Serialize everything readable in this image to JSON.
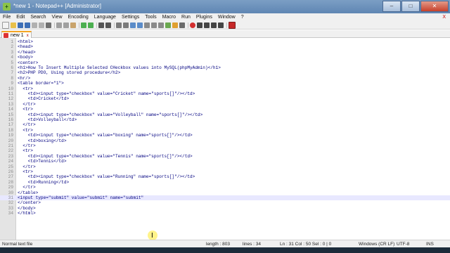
{
  "window": {
    "title": "*new 1 - Notepad++ [Administrator]",
    "app_icon": "notepad-plus-icon"
  },
  "menu": [
    "File",
    "Edit",
    "Search",
    "View",
    "Encoding",
    "Language",
    "Settings",
    "Tools",
    "Macro",
    "Run",
    "Plugins",
    "Window",
    "?"
  ],
  "menu_close": "X",
  "tab": {
    "label": "new 1",
    "close": "x"
  },
  "editor": {
    "current_line": 31,
    "lines": [
      {
        "n": "1",
        "text": "<html>"
      },
      {
        "n": "2",
        "text": "<head>"
      },
      {
        "n": "3",
        "text": "</head>"
      },
      {
        "n": "4",
        "text": "<body>"
      },
      {
        "n": "5",
        "text": "<center>"
      },
      {
        "n": "6",
        "text": "<h1>How To Insert Multiple Selected CHeckbox values into MySQL(phpMyAdmin)</h1>"
      },
      {
        "n": "7",
        "text": "<h2>PHP PDO, Using stored procedure</h2>"
      },
      {
        "n": "8",
        "text": "<hr/>"
      },
      {
        "n": "9",
        "text": "<table border=\"1\">"
      },
      {
        "n": "10",
        "text": "  <tr>"
      },
      {
        "n": "11",
        "text": "    <td><input type=\"checkbox\" value=\"Cricket\" name=\"sports[]\"/></td>"
      },
      {
        "n": "12",
        "text": "    <td>Cricket</td>"
      },
      {
        "n": "13",
        "text": "  </tr>"
      },
      {
        "n": "14",
        "text": "  <tr>"
      },
      {
        "n": "15",
        "text": "    <td><input type=\"checkbox\" value=\"Volleyball\" name=\"sports[]\"/></td>"
      },
      {
        "n": "16",
        "text": "    <td>Volleyball</td>"
      },
      {
        "n": "17",
        "text": "  </tr>"
      },
      {
        "n": "18",
        "text": "  <tr>"
      },
      {
        "n": "19",
        "text": "    <td><input type=\"checkbox\" value=\"boxing\" name=\"sports[]\"/></td>"
      },
      {
        "n": "20",
        "text": "    <td>boxing</td>"
      },
      {
        "n": "21",
        "text": "  </tr>"
      },
      {
        "n": "22",
        "text": "  <tr>"
      },
      {
        "n": "23",
        "text": "    <td><input type=\"checkbox\" value=\"Tennis\" name=\"sports[]\"/></td>"
      },
      {
        "n": "24",
        "text": "    <td>Tennis</td>"
      },
      {
        "n": "25",
        "text": "  </tr>"
      },
      {
        "n": "26",
        "text": "  <tr>"
      },
      {
        "n": "27",
        "text": "    <td><input type=\"checkbox\" value=\"Running\" name=\"sports[]\"/></td>"
      },
      {
        "n": "28",
        "text": "    <td>Running</td>"
      },
      {
        "n": "29",
        "text": "  </tr>"
      },
      {
        "n": "30",
        "text": "</table>"
      },
      {
        "n": "31",
        "text": "<input type=\"submit\" value=\"submit\" name=\"submit\""
      },
      {
        "n": "32",
        "text": "</center>"
      },
      {
        "n": "33",
        "text": "</body>"
      },
      {
        "n": "34",
        "text": "</html>"
      }
    ]
  },
  "status": {
    "file_type": "Normal text file",
    "length": "length : 803",
    "lines": "lines : 34",
    "position": "Ln : 31   Col : 50   Sel : 0 | 0",
    "eol": "Windows (CR LF)",
    "encoding": "UTF-8",
    "mode": "INS"
  },
  "colors": {
    "title_bar": "#6b91bd",
    "tab_accent": "#f5a623",
    "code_text": "#000080",
    "current_line": "#e8e8ff"
  }
}
